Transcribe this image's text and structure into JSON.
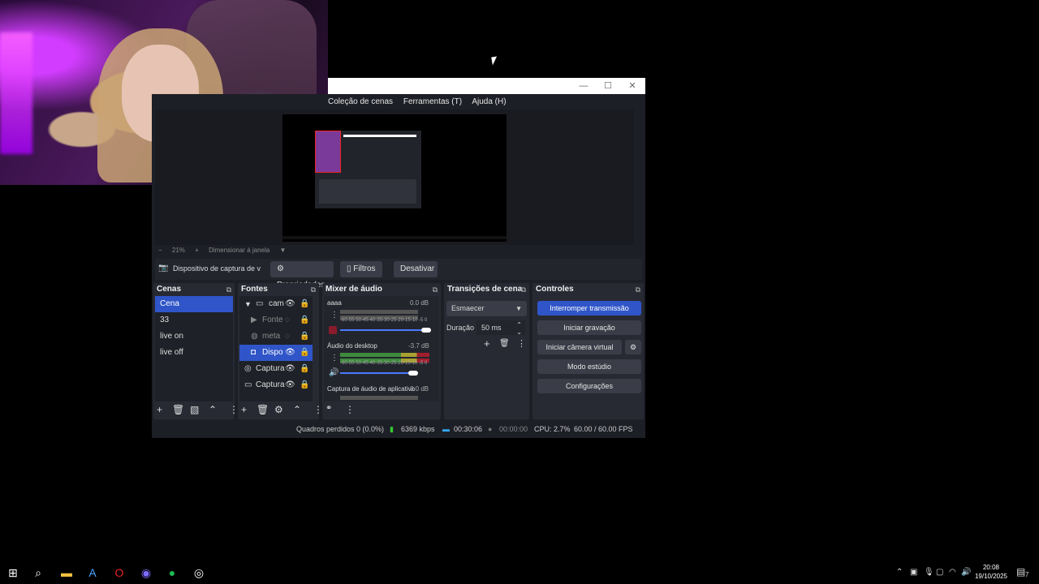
{
  "window": {
    "controls": {
      "minimize": "—",
      "maximize": "☐",
      "close": "✕"
    },
    "menu": [
      "Coleção de cenas",
      "Ferramentas (T)",
      "Ajuda (H)"
    ]
  },
  "preview": {
    "zoom_minus": "−",
    "zoom": "21%",
    "zoom_plus": "+",
    "fit_label": "Dimensionar à janela"
  },
  "source_toolbar": {
    "device_label": "Dispositivo de captura de v",
    "properties": "Propriedades",
    "filters": "Filtros",
    "disable": "Desativar"
  },
  "scenes": {
    "title": "Cenas",
    "items": [
      "Cena",
      "33",
      "live on",
      "live off"
    ],
    "selected_index": 0
  },
  "sources": {
    "title": "Fontes",
    "items": [
      {
        "label": "cam",
        "icon": "folder-icon",
        "visible": true
      },
      {
        "label": "Fonte",
        "icon": "play-icon",
        "visible": false
      },
      {
        "label": "meta",
        "icon": "globe-icon",
        "visible": false
      },
      {
        "label": "Dispo",
        "icon": "camera-icon",
        "visible": true
      },
      {
        "label": "Captura",
        "icon": "gamepad-icon",
        "visible": true
      },
      {
        "label": "Captura",
        "icon": "monitor-icon",
        "visible": true
      }
    ],
    "selected_index": 3
  },
  "mixer": {
    "title": "Mixer de áudio",
    "channels": [
      {
        "name": "aaaa",
        "db": "0.0 dB",
        "muted": true,
        "volume": 0.95
      },
      {
        "name": "Áudio do desktop",
        "db": "-3.7 dB",
        "muted": false,
        "volume": 0.78
      },
      {
        "name": "Captura de áudio de aplicativo",
        "db": "0.0 dB",
        "muted": false,
        "volume": 0.95
      }
    ],
    "scale": "-60-55-50-45-40-35-30-25-20-15-10 -5 0"
  },
  "transitions": {
    "title": "Transições de cena",
    "selected": "Esmaecer",
    "duration_label": "Duração",
    "duration_value": "50 ms"
  },
  "controls": {
    "title": "Controles",
    "stop_stream": "Interromper transmissão",
    "start_record": "Iniciar gravação",
    "virtual_cam": "Iniciar câmera virtual",
    "studio_mode": "Modo estúdio",
    "settings": "Configurações"
  },
  "status": {
    "dropped": "Quadros perdidos 0 (0.0%)",
    "bitrate": "6369 kbps",
    "stream_time": "00:30:06",
    "record_time": "00:00:00",
    "cpu": "CPU: 2.7%",
    "fps": "60.00 / 60.00 FPS"
  },
  "taskbar": {
    "clock_time": "20:08",
    "clock_date": "19/10/2025",
    "notification_count": "7"
  },
  "colors": {
    "accent": "#2f55c8",
    "background": "#1d1f26"
  }
}
